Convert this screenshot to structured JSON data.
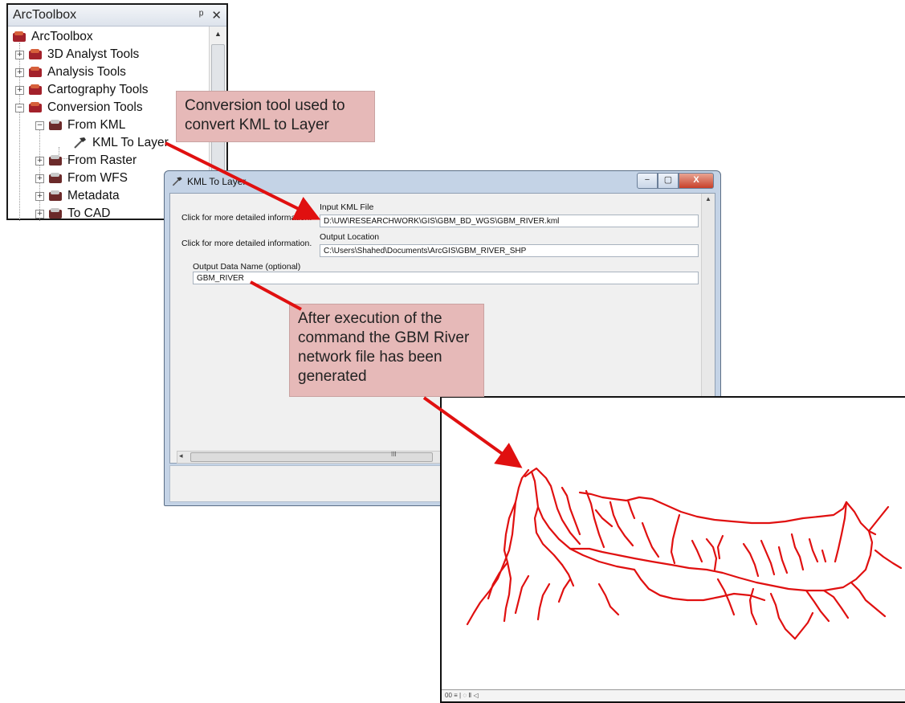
{
  "toolbox": {
    "title": "ArcToolbox",
    "pin_icon": "pin-icon",
    "close_icon": "close-icon",
    "root": "ArcToolbox",
    "items": [
      {
        "label": "3D Analyst Tools",
        "expander": "+"
      },
      {
        "label": "Analysis Tools",
        "expander": "+"
      },
      {
        "label": "Cartography Tools",
        "expander": "+"
      },
      {
        "label": "Conversion Tools",
        "expander": "−"
      },
      {
        "label": "From KML",
        "expander": "−"
      },
      {
        "label": "KML To Layer",
        "expander": ""
      },
      {
        "label": "From Raster",
        "expander": "+"
      },
      {
        "label": "From WFS",
        "expander": "+"
      },
      {
        "label": "Metadata",
        "expander": "+"
      },
      {
        "label": "To CAD",
        "expander": "+"
      }
    ]
  },
  "dialog": {
    "title": "KML To Layer",
    "minimize": "−",
    "maximize": "▢",
    "close": "X",
    "help_text_1": "Click for more detailed information.",
    "help_text_2": "Click for more detailed information.",
    "input_kml_label": "Input KML File",
    "input_kml_value": "D:\\UW\\RESEARCHWORK\\GIS\\GBM_BD_WGS\\GBM_RIVER.kml",
    "output_location_label": "Output Location",
    "output_location_value": "C:\\Users\\Shahed\\Documents\\ArcGIS\\GBM_RIVER_SHP",
    "output_name_label": "Output Data Name (optional)",
    "output_name_value": "GBM_RIVER",
    "hscroll_grip": "III"
  },
  "callouts": {
    "conversion": "Conversion tool used to convert KML to Layer",
    "execution": "After execution of the command the GBM River network file has been generated"
  },
  "map": {
    "river_color": "#e01010",
    "status_text": "00 ≡ | ◌ Ⅱ ◁"
  },
  "colors": {
    "callout_fill": "#e6b9b8",
    "arrow": "#e01010",
    "dialog_frame": "#c4d3e6"
  }
}
